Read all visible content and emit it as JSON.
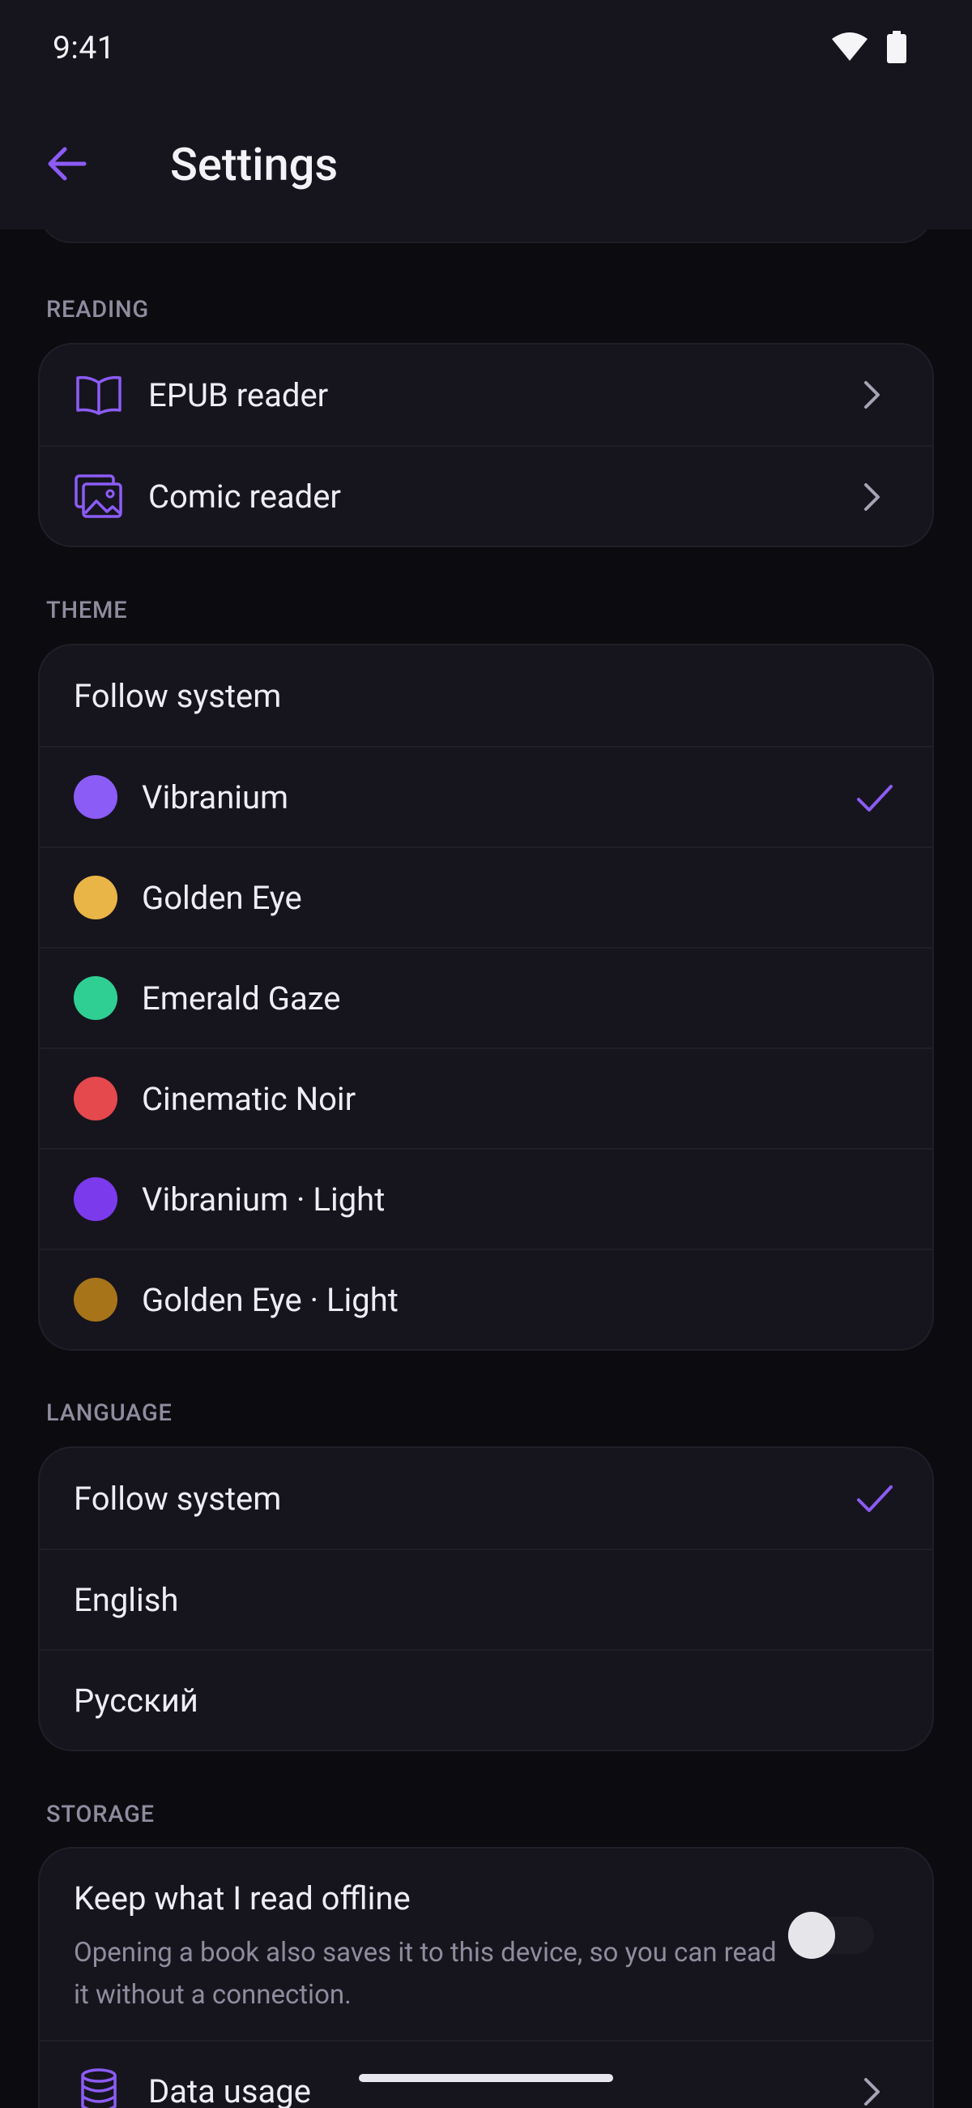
{
  "status_bar": {
    "time": "9:41"
  },
  "app_bar": {
    "title": "Settings"
  },
  "colors": {
    "accent": "#8c5cf6",
    "vibranium": "#8b5cf6",
    "golden_eye": "#e9b546",
    "emerald_gaze": "#2fcf93",
    "cinematic_noir": "#e5484d",
    "vibranium_light": "#7c3aed",
    "golden_eye_light": "#a8741a"
  },
  "sections": {
    "reading": {
      "label": "READING",
      "items": [
        {
          "label": "EPUB reader",
          "icon": "book-open-icon"
        },
        {
          "label": "Comic reader",
          "icon": "images-icon"
        }
      ]
    },
    "theme": {
      "label": "THEME",
      "follow_system": "Follow system",
      "items": [
        {
          "label": "Vibranium",
          "selected": true
        },
        {
          "label": "Golden Eye"
        },
        {
          "label": "Emerald Gaze"
        },
        {
          "label": "Cinematic Noir"
        },
        {
          "label": "Vibranium · Light"
        },
        {
          "label": "Golden Eye · Light"
        }
      ]
    },
    "language": {
      "label": "LANGUAGE",
      "items": [
        {
          "label": "Follow system",
          "selected": true
        },
        {
          "label": "English"
        },
        {
          "label": "Русский"
        }
      ]
    },
    "storage": {
      "label": "STORAGE",
      "offline": {
        "title": "Keep what I read offline",
        "description": "Opening a book also saves it to this device, so you can read it without a connection.",
        "enabled": false
      },
      "data_usage": {
        "label": "Data usage",
        "icon": "database-icon"
      }
    }
  }
}
